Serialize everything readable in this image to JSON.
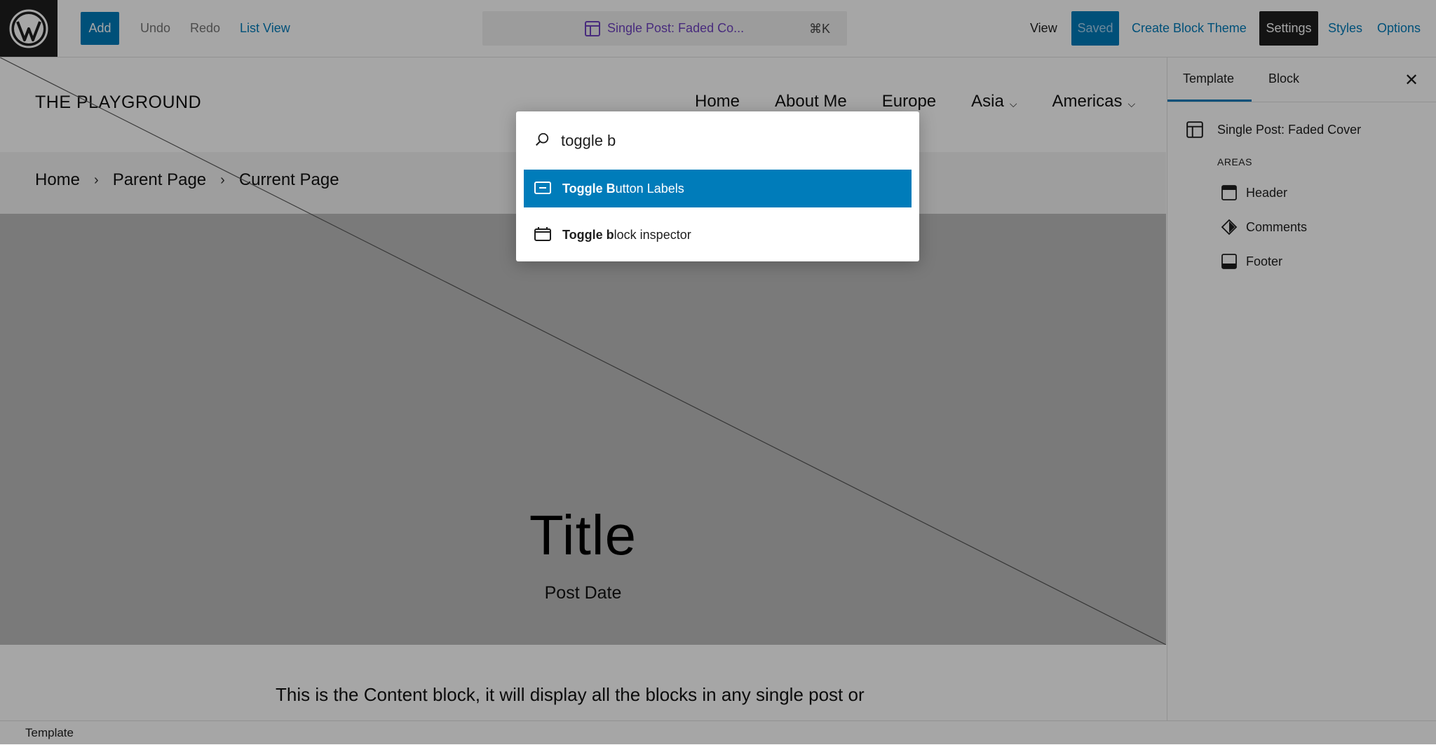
{
  "topbar": {
    "add_label": "Add",
    "undo_label": "Undo",
    "redo_label": "Redo",
    "list_view_label": "List View",
    "command_bar": {
      "title": "Single Post: Faded Co...",
      "shortcut": "⌘K"
    },
    "view_label": "View",
    "saved_label": "Saved",
    "create_theme_label": "Create Block Theme",
    "settings_label": "Settings",
    "styles_label": "Styles",
    "options_label": "Options"
  },
  "canvas": {
    "site_title": "THE PLAYGROUND",
    "nav": [
      {
        "label": "Home"
      },
      {
        "label": "About Me"
      },
      {
        "label": "Europe"
      },
      {
        "label": "Asia",
        "chevron": "⌵"
      },
      {
        "label": "Americas",
        "chevron": "⌵"
      }
    ],
    "breadcrumb": [
      "Home",
      "Parent Page",
      "Current Page"
    ],
    "breadcrumb_sep": "›",
    "post_title": "Title",
    "post_date": "Post Date",
    "content_text": "This is the Content block, it will display all the blocks in any single post or"
  },
  "sidebar": {
    "tabs": [
      {
        "label": "Template"
      },
      {
        "label": "Block"
      }
    ],
    "close_glyph": "✕",
    "template_name": "Single Post: Faded Cover",
    "areas_label": "AREAS",
    "areas": [
      {
        "label": "Header",
        "icon": "header-icon"
      },
      {
        "label": "Comments",
        "icon": "comments-icon"
      },
      {
        "label": "Footer",
        "icon": "footer-icon"
      }
    ]
  },
  "statusbar": {
    "text": "Template"
  },
  "command_palette": {
    "query": "toggle b",
    "results": [
      {
        "bold": "Toggle B",
        "rest": "utton Labels",
        "icon": "button-icon",
        "selected": true
      },
      {
        "bold": "Toggle b",
        "rest": "lock inspector",
        "icon": "inspector-icon",
        "selected": false
      }
    ]
  },
  "colors": {
    "accent": "#007cba",
    "dark": "#1e1e1e",
    "command_title": "#6f42c1"
  }
}
